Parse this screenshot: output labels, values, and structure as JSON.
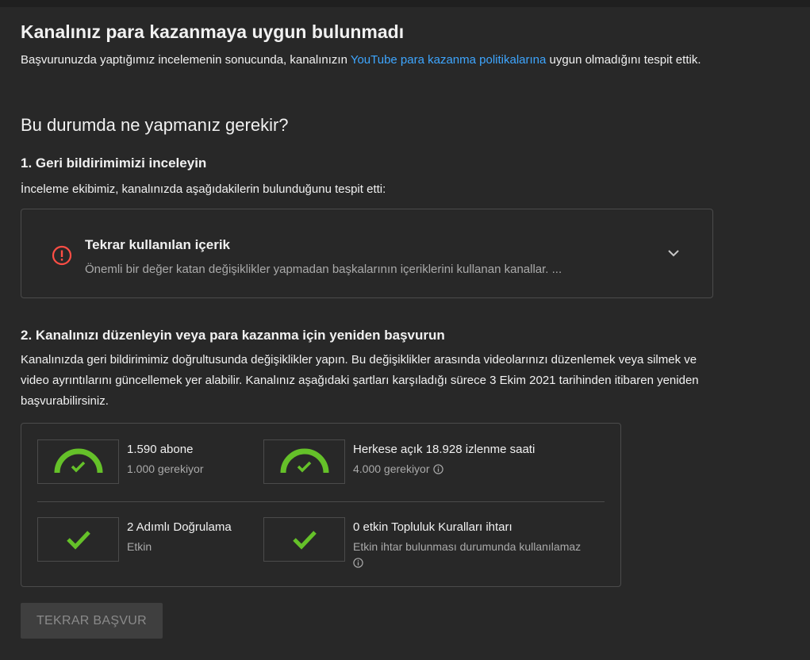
{
  "header": {
    "title": "Kanalınız para kazanmaya uygun bulunmadı",
    "intro_before": "Başvurunuzda yaptığımız incelemenin sonucunda, kanalınızın ",
    "intro_link": "YouTube para kazanma politikalarına",
    "intro_after": " uygun olmadığını tespit ettik."
  },
  "next_steps": {
    "heading": "Bu durumda ne yapmanız gerekir?",
    "step1": {
      "title": "1. Geri bildirimimizi inceleyin",
      "description": "İnceleme ekibimiz, kanalınızda aşağıdakilerin bulunduğunu tespit etti:",
      "issue": {
        "icon": "error-icon",
        "title": "Tekrar kullanılan içerik",
        "description": "Önemli bir değer katan değişiklikler yapmadan başkalarının içeriklerini kullanan kanallar. ..."
      }
    },
    "step2": {
      "title": "2. Kanalınızı düzenleyin veya para kazanma için yeniden başvurun",
      "description": "Kanalınızda geri bildirimimiz doğrultusunda değişiklikler yapın. Bu değişiklikler arasında videolarınızı düzenlemek veya silmek ve video ayrıntılarını güncellemek yer alabilir. Kanalınız aşağıdaki şartları karşıladığı sürece 3 Ekim 2021 tarihinden itibaren yeniden başvurabilirsiniz."
    }
  },
  "requirements": [
    {
      "title": "1.590 abone",
      "subtitle": "1.000 gerekiyor",
      "icon": "gauge-check-icon",
      "progress": 1.0
    },
    {
      "title": "Herkese açık 18.928 izlenme saati",
      "subtitle": "4.000 gerekiyor",
      "icon": "gauge-check-icon",
      "progress": 1.0
    },
    {
      "title": "2 Adımlı Doğrulama",
      "subtitle": "Etkin",
      "icon": "check-icon"
    },
    {
      "title": "0 etkin Topluluk Kuralları ihtarı",
      "subtitle": "Etkin ihtar bulunması durumunda kullanılamaz",
      "icon": "check-icon"
    }
  ],
  "actions": {
    "reapply_label": "TEKRAR BAŞVUR"
  },
  "colors": {
    "accent_green": "#65c129",
    "error_red": "#ff4e45",
    "link_blue": "#3ea6ff"
  }
}
